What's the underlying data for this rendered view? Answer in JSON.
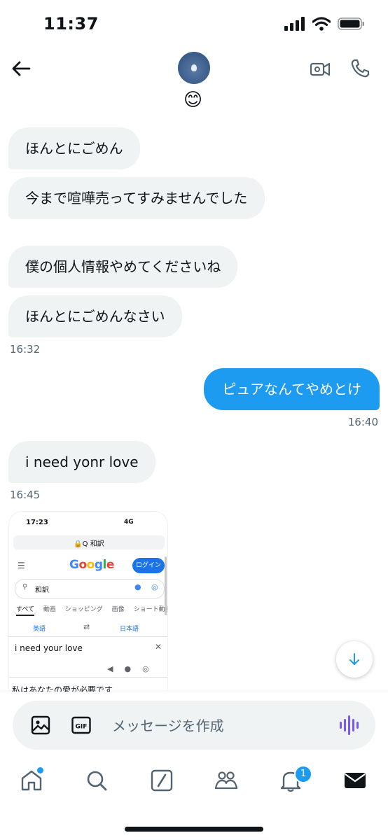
{
  "status_bar": {
    "time": "11:37"
  },
  "header": {
    "contact_name_emoji": "😊"
  },
  "messages": [
    {
      "direction": "in",
      "text": "ほんとにごめん"
    },
    {
      "direction": "in",
      "text": "今まで喧嘩売ってすみませんでした"
    },
    {
      "direction": "in",
      "text": "僕の個人情報やめてくださいね"
    },
    {
      "direction": "in",
      "text": "ほんとにごめんなさい"
    },
    {
      "direction": "out",
      "text": "ピュアなんてやめとけ"
    },
    {
      "direction": "in",
      "text": "i need yonr love"
    }
  ],
  "timestamps": [
    "16:32",
    "16:40",
    "16:45"
  ],
  "image_message": {
    "status_time": "17:23",
    "status_right": "4G",
    "url": "🔒Q 和訳",
    "logo": "Google",
    "login_label": "ログイン",
    "search_query": "和訳",
    "tabs": [
      "すべて",
      "動画",
      "ショッピング",
      "画像",
      "ショート動画"
    ],
    "source_lang": "英語",
    "target_lang": "日本語",
    "input_text": "i need your love",
    "output_text": "私はあなたの愛が必要です"
  },
  "composer": {
    "placeholder": "メッセージを作成"
  },
  "tabbar": {
    "notification_count": "1"
  },
  "colors": {
    "accent": "#1d9bf0",
    "bubble_in": "#eff3f4",
    "voice": "#7856ff"
  }
}
